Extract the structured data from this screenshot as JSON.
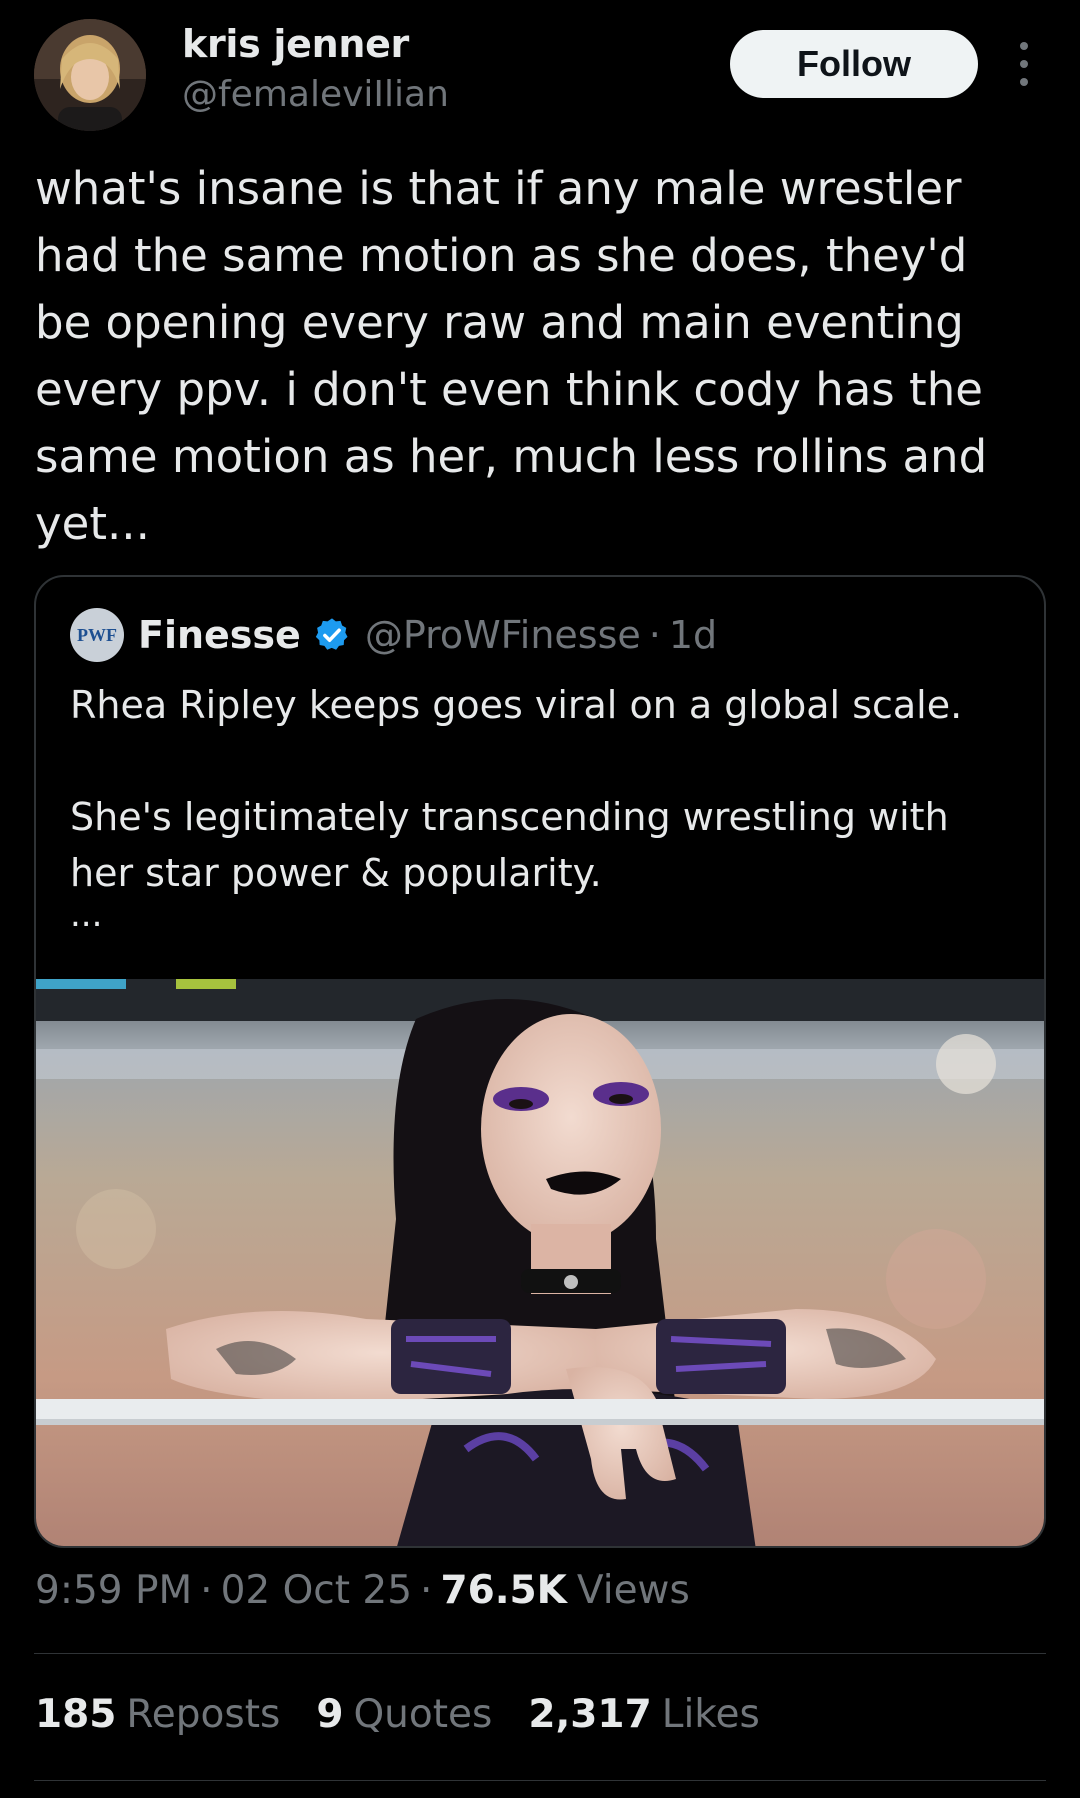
{
  "author": {
    "name": "kris jenner",
    "handle": "@femaleviIlian",
    "follow_label": "Follow"
  },
  "tweet": {
    "text": "what's insane is that if any male wrestler\nhad the same motion as she does, they'd\nbe opening every raw and main eventing\nevery ppv. i don't even think cody has the\nsame motion as her, much less rollins and\nyet..."
  },
  "quote": {
    "avatar_text": "PWF",
    "name": "Finesse",
    "handle": "@ProWFinesse",
    "separator": "·",
    "time": "1d",
    "text": "Rhea Ripley keeps goes viral on a global scale.\n\nShe's legitimately transcending wrestling with\nher star power & popularity.",
    "ellipsis": "...",
    "verified_color": "#1d9bf0"
  },
  "meta": {
    "time": "9:59 PM",
    "separator": "·",
    "date": "02 Oct 25",
    "views_count": "76.5K",
    "views_label": "Views"
  },
  "stats": {
    "reposts_count": "185",
    "reposts_label": "Reposts",
    "quotes_count": "9",
    "quotes_label": "Quotes",
    "likes_count": "2,317",
    "likes_label": "Likes"
  },
  "icons": {
    "more": "more-vertical-icon",
    "verified": "verified-badge-icon"
  }
}
